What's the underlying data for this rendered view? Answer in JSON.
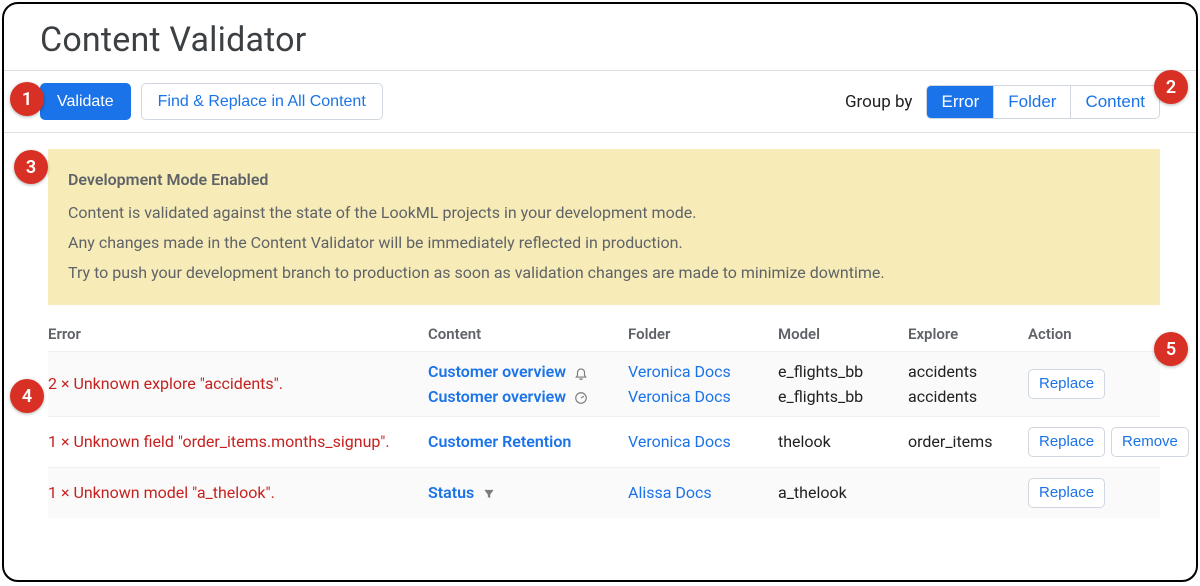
{
  "title": "Content Validator",
  "toolbar": {
    "validate_label": "Validate",
    "find_replace_label": "Find & Replace in All Content",
    "group_by_label": "Group by",
    "group_options": {
      "error": "Error",
      "folder": "Folder",
      "content": "Content"
    }
  },
  "notice": {
    "title": "Development Mode Enabled",
    "line1": "Content is validated against the state of the LookML projects in your development mode.",
    "line2": "Any changes made in the Content Validator will be immediately reflected in production.",
    "line3": "Try to push your development branch to production as soon as validation changes are made to minimize downtime."
  },
  "columns": {
    "error": "Error",
    "content": "Content",
    "folder": "Folder",
    "model": "Model",
    "explore": "Explore",
    "action": "Action"
  },
  "actions": {
    "replace": "Replace",
    "remove": "Remove"
  },
  "rows": [
    {
      "error": "2 × Unknown explore \"accidents\".",
      "content": [
        {
          "label": "Customer overview",
          "icon": "notify"
        },
        {
          "label": "Customer overview",
          "icon": "gauge"
        }
      ],
      "folder": [
        "Veronica Docs",
        "Veronica Docs"
      ],
      "model": [
        "e_flights_bb",
        "e_flights_bb"
      ],
      "explore": [
        "accidents",
        "accidents"
      ],
      "has_remove": false
    },
    {
      "error": "1 × Unknown field \"order_items.months_signup\".",
      "content": [
        {
          "label": "Customer Retention",
          "icon": null
        }
      ],
      "folder": [
        "Veronica Docs"
      ],
      "model": [
        "thelook"
      ],
      "explore": [
        "order_items"
      ],
      "has_remove": true
    },
    {
      "error": "1 × Unknown model \"a_thelook\".",
      "content": [
        {
          "label": "Status",
          "icon": "filter"
        }
      ],
      "folder": [
        "Alissa Docs"
      ],
      "model": [
        "a_thelook"
      ],
      "explore": [
        ""
      ],
      "has_remove": false
    }
  ],
  "callouts": [
    "1",
    "2",
    "3",
    "4",
    "5"
  ]
}
